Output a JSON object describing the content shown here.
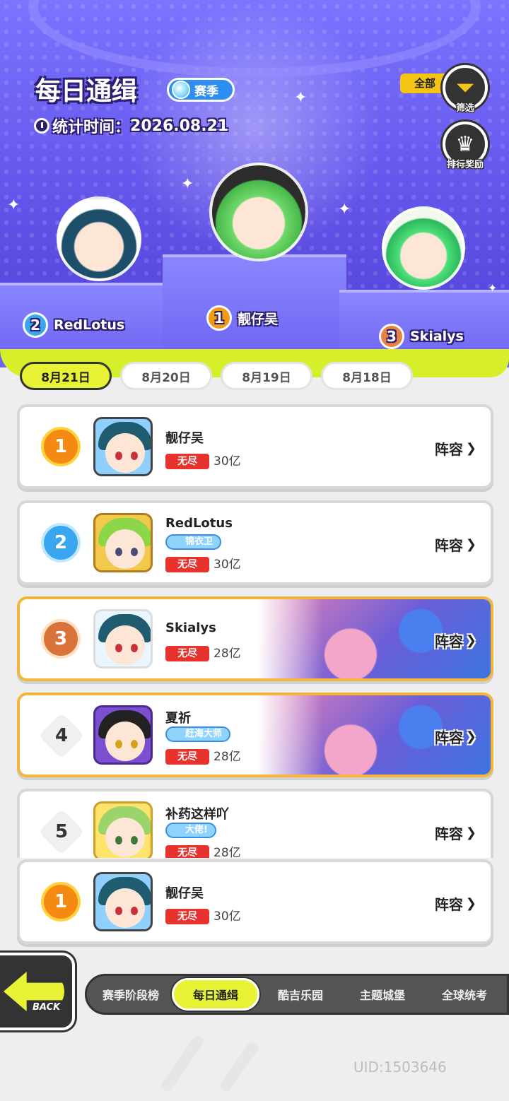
{
  "header": {
    "title": "每日通缉",
    "season_label": "赛季",
    "stat_time_label": "统计时间：",
    "stat_time_value": "2026.08.21",
    "filter_all_label": "全部",
    "filter_label": "筛选",
    "reward_label": "排行奖励"
  },
  "podium": [
    {
      "rank": "2",
      "name": "RedLotus"
    },
    {
      "rank": "1",
      "name": "靓仔吴"
    },
    {
      "rank": "3",
      "name": "Skialys"
    }
  ],
  "date_tabs": [
    {
      "label": "8月21日",
      "active": true
    },
    {
      "label": "8月20日",
      "active": false
    },
    {
      "label": "8月19日",
      "active": false
    },
    {
      "label": "8月18日",
      "active": false
    }
  ],
  "ranks": [
    {
      "rank": "1",
      "name": "靓仔吴",
      "title_tag": "",
      "mode": "无尽",
      "score": "30亿",
      "lineup": "阵容"
    },
    {
      "rank": "2",
      "name": "RedLotus",
      "title_tag": "锦衣卫",
      "mode": "无尽",
      "score": "30亿",
      "lineup": "阵容"
    },
    {
      "rank": "3",
      "name": "Skialys",
      "title_tag": "",
      "mode": "无尽",
      "score": "28亿",
      "lineup": "阵容"
    },
    {
      "rank": "4",
      "name": "夏祈",
      "title_tag": "赶海大师",
      "mode": "无尽",
      "score": "28亿",
      "lineup": "阵容"
    },
    {
      "rank": "5",
      "name": "补药这样吖",
      "title_tag": "大佬!",
      "mode": "无尽",
      "score": "28亿",
      "lineup": "阵容"
    }
  ],
  "my_rank": {
    "rank": "1",
    "name": "靓仔吴",
    "mode": "无尽",
    "score": "30亿",
    "lineup": "阵容"
  },
  "bottom": {
    "back_label": "BACK",
    "nav": [
      "赛季阶段榜",
      "每日通缉",
      "酷吉乐园",
      "主题城堡",
      "全球统考"
    ],
    "uid": "UID:1503646"
  },
  "colors": {
    "accent": "#e7f234",
    "hero": "#6a5cf0",
    "mode_tag": "#e8322e"
  }
}
